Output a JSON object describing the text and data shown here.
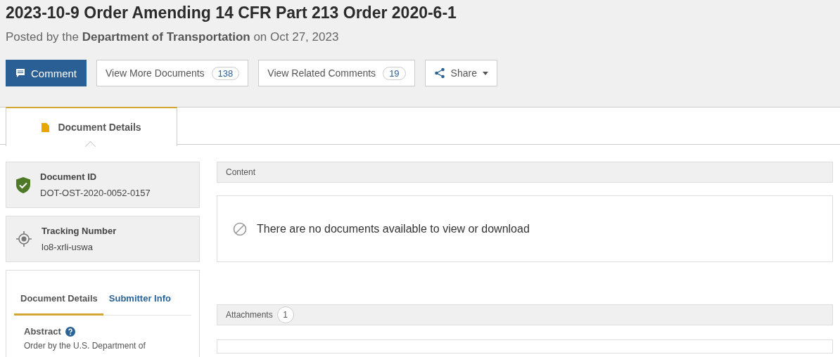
{
  "title": "2023-10-9 Order Amending 14 CFR Part 213 Order 2020-6-1",
  "posted": "Posted by the **Department of Transportation** on Oct 27, 2023",
  "actions": [
    {
      "kind": "primary",
      "label": "Comment"
    },
    {
      "kind": "count",
      "label": "View More Documents",
      "count": "138"
    },
    {
      "kind": "count",
      "label": "View Related Comments",
      "count": "19"
    },
    {
      "kind": "menu",
      "label": "Share"
    }
  ],
  "page_tabs": [
    {
      "label": "Document Details",
      "selected": true
    }
  ],
  "id_cards": [
    {
      "kind": "verified",
      "label": "Document ID",
      "value": "DOT-OST-2020-0052-0157"
    },
    {
      "kind": "tracking",
      "label": "Tracking Number",
      "value": "lo8-xrli-uswa"
    }
  ],
  "detail_tabs": [
    {
      "label": "Document Details",
      "selected": true
    },
    {
      "label": "Submitter Info",
      "selected": false
    }
  ],
  "abstract": {
    "label": "Abstract",
    "text": "Order by the U.S. Department of"
  },
  "sections": [
    {
      "title": "Content",
      "message": "There are no documents available to view or download"
    },
    {
      "title": "Attachments",
      "count": "1"
    }
  ]
}
